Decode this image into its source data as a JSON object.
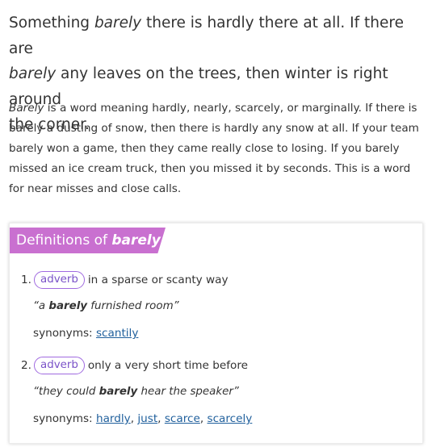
{
  "short_definition": {
    "p1": "Something ",
    "i1": "barely",
    "p2": " there is hardly there at all. If there are",
    "i2": "barely",
    "p3": " any leaves on the trees, then winter is right around",
    "p4": "the corner."
  },
  "long_definition": {
    "i1": "Barely",
    "p1": " is a word meaning hardly, nearly, scarcely, or marginally. If there is barely a dusting of snow, then there is hardly any snow at all. If your team barely won a game, then they came really close to losing. If you barely missed an ice cream truck, then you missed it by seconds. This is a word for near misses and close calls."
  },
  "definitions_card": {
    "title_prefix": "Definitions of ",
    "title_word": "barely",
    "banner_color": "#c970d0",
    "senses": [
      {
        "number": "1.",
        "part_of_speech": "adverb",
        "definition": "in a sparse or scanty way",
        "example_open": "“a ",
        "example_word": "barely",
        "example_rest": " furnished room”",
        "synonyms_label": "synonyms:",
        "synonyms": [
          "scantily"
        ]
      },
      {
        "number": "2.",
        "part_of_speech": "adverb",
        "definition": "only a very short time before",
        "example_open": "“they could ",
        "example_word": "barely",
        "example_rest": " hear the speaker”",
        "synonyms_label": "synonyms:",
        "synonyms": [
          "hardly",
          "just",
          "scarce",
          "scarcely"
        ]
      }
    ]
  }
}
